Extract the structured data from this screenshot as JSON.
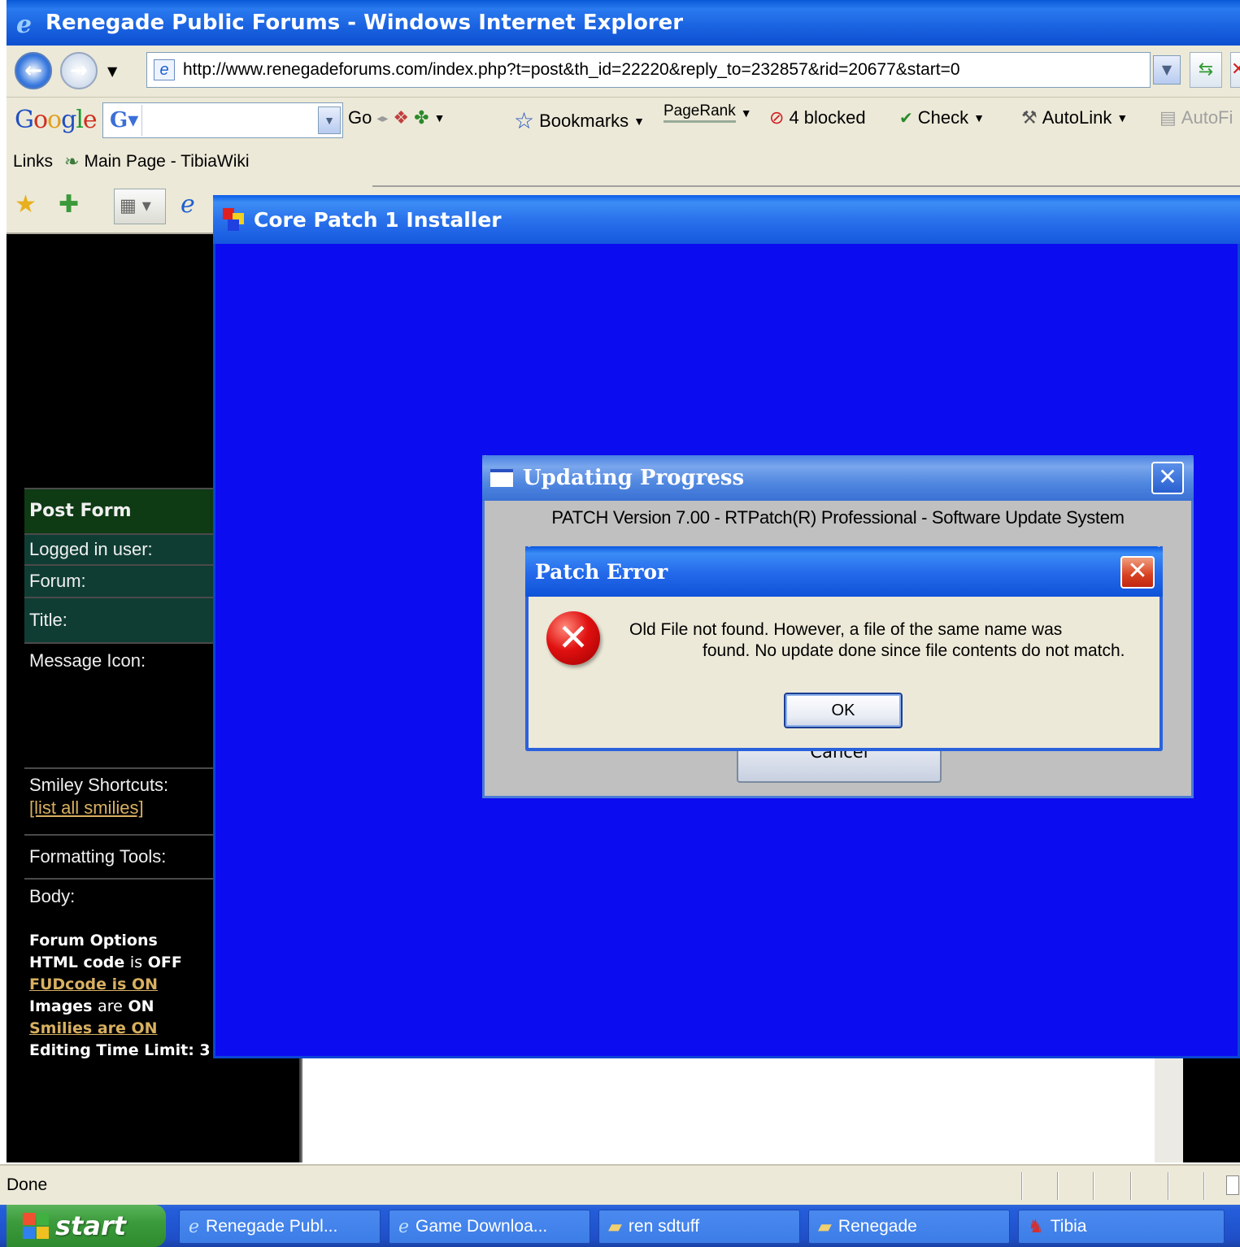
{
  "window": {
    "title": "Renegade Public Forums - Windows Internet Explorer"
  },
  "address_bar": {
    "url": "http://www.renegadeforums.com/index.php?t=post&th_id=22220&reply_to=232857&rid=20677&start=0"
  },
  "google_toolbar": {
    "logo": "Google",
    "go_label": "Go",
    "bookmarks_label": "Bookmarks",
    "pagerank_label": "PageRank",
    "blocked_label": "4 blocked",
    "check_label": "Check",
    "autolink_label": "AutoLink",
    "autofill_label": "AutoFi"
  },
  "links_bar": {
    "label": "Links",
    "items": [
      {
        "label": "Main Page - TibiaWiki"
      }
    ]
  },
  "forum_sidebar": {
    "post_form": "Post Form",
    "logged_in": "Logged in user:",
    "forum": "Forum:",
    "title": "Title:",
    "message_icon": "Message Icon:",
    "smiley_shortcuts": "Smiley Shortcuts:",
    "list_smilies": "[list all smilies]",
    "formatting_tools": "Formatting Tools:",
    "body": "Body:",
    "forum_options": "Forum Options",
    "html_code": "HTML code",
    "is": "is",
    "off": "OFF",
    "fudcode": "FUDcode is ON",
    "images": "Images",
    "are": "are",
    "on": "ON",
    "smilies": "Smilies are ON",
    "editing_time": "Editing Time Limit: 3"
  },
  "installer": {
    "title": "Core Patch 1 Installer"
  },
  "updating_dialog": {
    "title": "Updating Progress",
    "line1": "PATCH  Version 7.00 - RTPatch(R) Professional - Software Update System",
    "cancel_label": "Cancel"
  },
  "patch_error": {
    "title": "Patch Error",
    "message_line1": "Old File not found. However, a file of the same name was",
    "message_line2": "found. No update done since file contents do not match.",
    "ok_label": "OK"
  },
  "status_bar": {
    "status": "Done"
  },
  "taskbar": {
    "start_label": "start",
    "tasks": [
      {
        "label": "Renegade Publ...",
        "icon": "ie-icon"
      },
      {
        "label": "Game Downloa...",
        "icon": "ie-icon"
      },
      {
        "label": "ren sdtuff",
        "icon": "folder-icon"
      },
      {
        "label": "Renegade",
        "icon": "folder-icon"
      },
      {
        "label": "Tibia",
        "icon": "tibia-icon"
      }
    ]
  },
  "colors": {
    "installer_bg": "#0c0cf0",
    "xp_blue": "#245edb",
    "sidebar_header": "#0e3a14",
    "sidebar_teal": "#0f3d33",
    "link_gold": "#d8b060"
  }
}
